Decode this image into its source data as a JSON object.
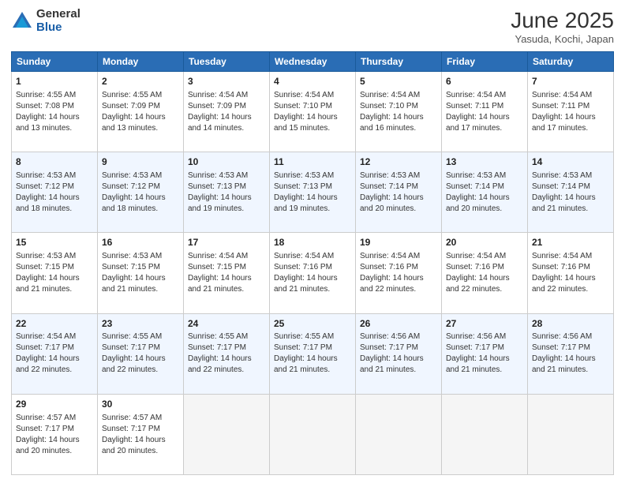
{
  "header": {
    "logo_general": "General",
    "logo_blue": "Blue",
    "month": "June 2025",
    "location": "Yasuda, Kochi, Japan"
  },
  "days_of_week": [
    "Sunday",
    "Monday",
    "Tuesday",
    "Wednesday",
    "Thursday",
    "Friday",
    "Saturday"
  ],
  "weeks": [
    [
      {
        "num": "1",
        "info": "Sunrise: 4:55 AM\nSunset: 7:08 PM\nDaylight: 14 hours\nand 13 minutes."
      },
      {
        "num": "2",
        "info": "Sunrise: 4:55 AM\nSunset: 7:09 PM\nDaylight: 14 hours\nand 13 minutes."
      },
      {
        "num": "3",
        "info": "Sunrise: 4:54 AM\nSunset: 7:09 PM\nDaylight: 14 hours\nand 14 minutes."
      },
      {
        "num": "4",
        "info": "Sunrise: 4:54 AM\nSunset: 7:10 PM\nDaylight: 14 hours\nand 15 minutes."
      },
      {
        "num": "5",
        "info": "Sunrise: 4:54 AM\nSunset: 7:10 PM\nDaylight: 14 hours\nand 16 minutes."
      },
      {
        "num": "6",
        "info": "Sunrise: 4:54 AM\nSunset: 7:11 PM\nDaylight: 14 hours\nand 17 minutes."
      },
      {
        "num": "7",
        "info": "Sunrise: 4:54 AM\nSunset: 7:11 PM\nDaylight: 14 hours\nand 17 minutes."
      }
    ],
    [
      {
        "num": "8",
        "info": "Sunrise: 4:53 AM\nSunset: 7:12 PM\nDaylight: 14 hours\nand 18 minutes."
      },
      {
        "num": "9",
        "info": "Sunrise: 4:53 AM\nSunset: 7:12 PM\nDaylight: 14 hours\nand 18 minutes."
      },
      {
        "num": "10",
        "info": "Sunrise: 4:53 AM\nSunset: 7:13 PM\nDaylight: 14 hours\nand 19 minutes."
      },
      {
        "num": "11",
        "info": "Sunrise: 4:53 AM\nSunset: 7:13 PM\nDaylight: 14 hours\nand 19 minutes."
      },
      {
        "num": "12",
        "info": "Sunrise: 4:53 AM\nSunset: 7:14 PM\nDaylight: 14 hours\nand 20 minutes."
      },
      {
        "num": "13",
        "info": "Sunrise: 4:53 AM\nSunset: 7:14 PM\nDaylight: 14 hours\nand 20 minutes."
      },
      {
        "num": "14",
        "info": "Sunrise: 4:53 AM\nSunset: 7:14 PM\nDaylight: 14 hours\nand 21 minutes."
      }
    ],
    [
      {
        "num": "15",
        "info": "Sunrise: 4:53 AM\nSunset: 7:15 PM\nDaylight: 14 hours\nand 21 minutes."
      },
      {
        "num": "16",
        "info": "Sunrise: 4:53 AM\nSunset: 7:15 PM\nDaylight: 14 hours\nand 21 minutes."
      },
      {
        "num": "17",
        "info": "Sunrise: 4:54 AM\nSunset: 7:15 PM\nDaylight: 14 hours\nand 21 minutes."
      },
      {
        "num": "18",
        "info": "Sunrise: 4:54 AM\nSunset: 7:16 PM\nDaylight: 14 hours\nand 21 minutes."
      },
      {
        "num": "19",
        "info": "Sunrise: 4:54 AM\nSunset: 7:16 PM\nDaylight: 14 hours\nand 22 minutes."
      },
      {
        "num": "20",
        "info": "Sunrise: 4:54 AM\nSunset: 7:16 PM\nDaylight: 14 hours\nand 22 minutes."
      },
      {
        "num": "21",
        "info": "Sunrise: 4:54 AM\nSunset: 7:16 PM\nDaylight: 14 hours\nand 22 minutes."
      }
    ],
    [
      {
        "num": "22",
        "info": "Sunrise: 4:54 AM\nSunset: 7:17 PM\nDaylight: 14 hours\nand 22 minutes."
      },
      {
        "num": "23",
        "info": "Sunrise: 4:55 AM\nSunset: 7:17 PM\nDaylight: 14 hours\nand 22 minutes."
      },
      {
        "num": "24",
        "info": "Sunrise: 4:55 AM\nSunset: 7:17 PM\nDaylight: 14 hours\nand 22 minutes."
      },
      {
        "num": "25",
        "info": "Sunrise: 4:55 AM\nSunset: 7:17 PM\nDaylight: 14 hours\nand 21 minutes."
      },
      {
        "num": "26",
        "info": "Sunrise: 4:56 AM\nSunset: 7:17 PM\nDaylight: 14 hours\nand 21 minutes."
      },
      {
        "num": "27",
        "info": "Sunrise: 4:56 AM\nSunset: 7:17 PM\nDaylight: 14 hours\nand 21 minutes."
      },
      {
        "num": "28",
        "info": "Sunrise: 4:56 AM\nSunset: 7:17 PM\nDaylight: 14 hours\nand 21 minutes."
      }
    ],
    [
      {
        "num": "29",
        "info": "Sunrise: 4:57 AM\nSunset: 7:17 PM\nDaylight: 14 hours\nand 20 minutes."
      },
      {
        "num": "30",
        "info": "Sunrise: 4:57 AM\nSunset: 7:17 PM\nDaylight: 14 hours\nand 20 minutes."
      },
      {
        "num": "",
        "info": ""
      },
      {
        "num": "",
        "info": ""
      },
      {
        "num": "",
        "info": ""
      },
      {
        "num": "",
        "info": ""
      },
      {
        "num": "",
        "info": ""
      }
    ]
  ]
}
